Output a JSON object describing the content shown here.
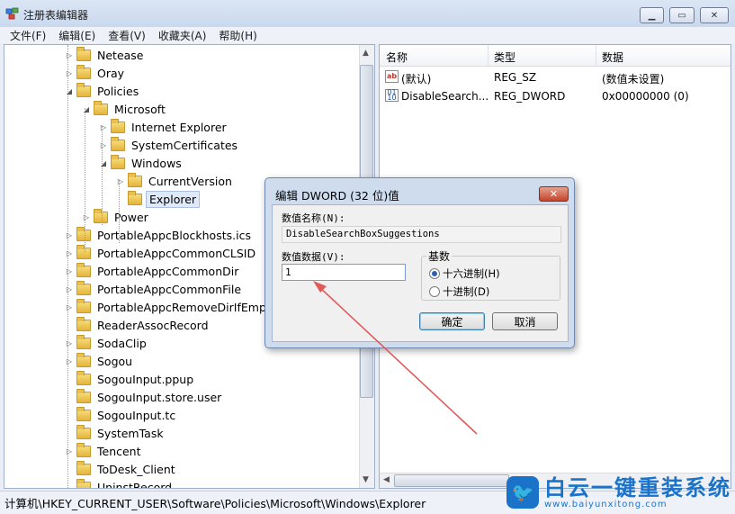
{
  "window": {
    "title": "注册表编辑器"
  },
  "menu": [
    "文件(F)",
    "编辑(E)",
    "查看(V)",
    "收藏夹(A)",
    "帮助(H)"
  ],
  "tree": [
    {
      "label": "Netease",
      "depth": 0,
      "expander": "closed"
    },
    {
      "label": "Oray",
      "depth": 0,
      "expander": "closed"
    },
    {
      "label": "Policies",
      "depth": 0,
      "expander": "open"
    },
    {
      "label": "Microsoft",
      "depth": 1,
      "expander": "open"
    },
    {
      "label": "Internet Explorer",
      "depth": 2,
      "expander": "closed"
    },
    {
      "label": "SystemCertificates",
      "depth": 2,
      "expander": "closed"
    },
    {
      "label": "Windows",
      "depth": 2,
      "expander": "open"
    },
    {
      "label": "CurrentVersion",
      "depth": 3,
      "expander": "closed"
    },
    {
      "label": "Explorer",
      "depth": 3,
      "expander": "none",
      "selected": true
    },
    {
      "label": "Power",
      "depth": 1,
      "expander": "closed"
    },
    {
      "label": "PortableAppcBlockhosts.ics",
      "depth": 0,
      "expander": "closed"
    },
    {
      "label": "PortableAppcCommonCLSID",
      "depth": 0,
      "expander": "closed"
    },
    {
      "label": "PortableAppcCommonDir",
      "depth": 0,
      "expander": "closed"
    },
    {
      "label": "PortableAppcCommonFile",
      "depth": 0,
      "expander": "closed"
    },
    {
      "label": "PortableAppcRemoveDirIfEmpty",
      "depth": 0,
      "expander": "closed"
    },
    {
      "label": "ReaderAssocRecord",
      "depth": 0,
      "expander": "none"
    },
    {
      "label": "SodaClip",
      "depth": 0,
      "expander": "closed"
    },
    {
      "label": "Sogou",
      "depth": 0,
      "expander": "closed"
    },
    {
      "label": "SogouInput.ppup",
      "depth": 0,
      "expander": "none"
    },
    {
      "label": "SogouInput.store.user",
      "depth": 0,
      "expander": "none"
    },
    {
      "label": "SogouInput.tc",
      "depth": 0,
      "expander": "none"
    },
    {
      "label": "SystemTask",
      "depth": 0,
      "expander": "none"
    },
    {
      "label": "Tencent",
      "depth": 0,
      "expander": "closed"
    },
    {
      "label": "ToDesk_Client",
      "depth": 0,
      "expander": "none"
    },
    {
      "label": "UninstRecord",
      "depth": 0,
      "expander": "none"
    }
  ],
  "list": {
    "columns": [
      "名称",
      "类型",
      "数据"
    ],
    "rows": [
      {
        "icon": "string-value-icon",
        "name": "(默认)",
        "type": "REG_SZ",
        "data": "(数值未设置)"
      },
      {
        "icon": "dword-value-icon",
        "name": "DisableSearch...",
        "type": "REG_DWORD",
        "data": "0x00000000 (0)"
      }
    ]
  },
  "status": {
    "path": "计算机\\HKEY_CURRENT_USER\\Software\\Policies\\Microsoft\\Windows\\Explorer"
  },
  "dialog": {
    "title": "编辑 DWORD (32 位)值",
    "name_label": "数值名称(N):",
    "name_value": "DisableSearchBoxSuggestions",
    "data_label": "数值数据(V):",
    "data_value": "1",
    "base_label": "基数",
    "hex_label": "十六进制(H)",
    "dec_label": "十进制(D)",
    "selected_base": "hex",
    "ok_label": "确定",
    "cancel_label": "取消"
  },
  "watermark": {
    "title": "白云一键重装系统",
    "url": "www.baiyunxitong.com"
  },
  "colors": {
    "accent": "#1a73c9",
    "annotation_arrow": "#e05a5a"
  }
}
